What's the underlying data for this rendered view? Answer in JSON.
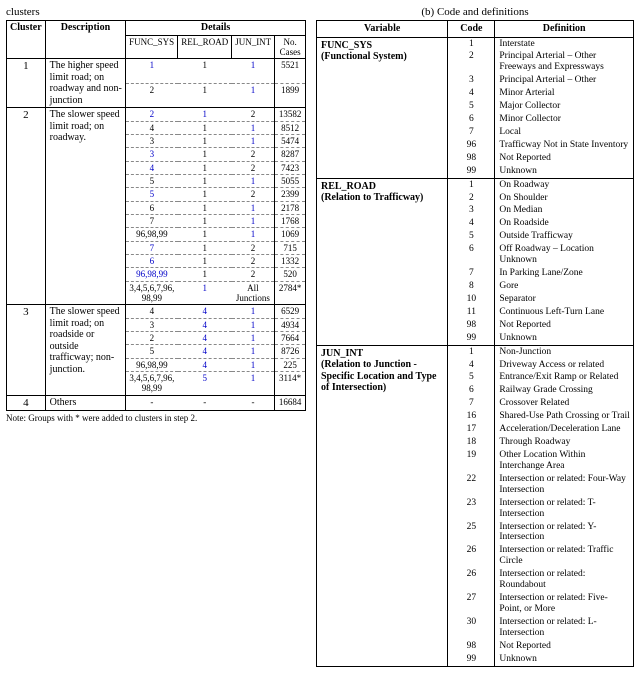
{
  "caption_left": "clusters",
  "caption_right": "(b) Code and definitions",
  "left_headers": {
    "cluster": "Cluster",
    "description": "Description",
    "details": "Details",
    "func_sys": "FUNC_SYS",
    "rel_road": "REL_ROAD",
    "jun_int": "JUN_INT",
    "cases": "No. Cases"
  },
  "right_headers": {
    "variable": "Variable",
    "code": "Code",
    "definition": "Definition"
  },
  "note": "Note: Groups with * were added to clusters in step 2.",
  "cluster1": {
    "id": "1",
    "desc": "The higher speed limit road; on roadway and non-junction",
    "rows": [
      {
        "f": "1",
        "r": "1",
        "j": "1",
        "n": "5521",
        "fb": true,
        "jb": true
      },
      {
        "f": "2",
        "r": "1",
        "j": "1",
        "n": "1899",
        "jb": true
      }
    ]
  },
  "cluster2": {
    "id": "2",
    "desc": "The slower speed limit road; on roadway.",
    "rows": [
      {
        "f": "2",
        "r": "1",
        "j": "2",
        "n": "13582",
        "fb": true,
        "rb": true
      },
      {
        "f": "4",
        "r": "1",
        "j": "1",
        "n": "8512",
        "jb": true
      },
      {
        "f": "3",
        "r": "1",
        "j": "1",
        "n": "5474",
        "jb": true
      },
      {
        "f": "3",
        "r": "1",
        "j": "2",
        "n": "8287",
        "fb": true
      },
      {
        "f": "4",
        "r": "1",
        "j": "2",
        "n": "7423",
        "fb": true
      },
      {
        "f": "5",
        "r": "1",
        "j": "1",
        "n": "5055",
        "jb": true
      },
      {
        "f": "5",
        "r": "1",
        "j": "2",
        "n": "2399",
        "fb": true
      },
      {
        "f": "6",
        "r": "1",
        "j": "1",
        "n": "2178",
        "jb": true
      },
      {
        "f": "7",
        "r": "1",
        "j": "1",
        "n": "1768",
        "jb": true
      },
      {
        "f": "96,98,99",
        "r": "1",
        "j": "1",
        "n": "1069",
        "jb": true
      },
      {
        "f": "7",
        "r": "1",
        "j": "2",
        "n": "715",
        "fb": true
      },
      {
        "f": "6",
        "r": "1",
        "j": "2",
        "n": "1332",
        "fb": true
      },
      {
        "f": "96,98,99",
        "r": "1",
        "j": "2",
        "n": "520",
        "fb": true
      },
      {
        "f": "3,4,5,6,7,96,\n98,99",
        "r": "1",
        "j": "All\nJunctions",
        "n": "2784*",
        "rb": true
      }
    ]
  },
  "cluster3": {
    "id": "3",
    "desc": "The slower speed limit road; on roadside or outside trafficway; non-junction.",
    "rows": [
      {
        "f": "4",
        "r": "4",
        "j": "1",
        "n": "6529",
        "rb": true,
        "jb": true
      },
      {
        "f": "3",
        "r": "4",
        "j": "1",
        "n": "4934",
        "rb": true,
        "jb": true
      },
      {
        "f": "2",
        "r": "4",
        "j": "1",
        "n": "7664",
        "rb": true,
        "jb": true
      },
      {
        "f": "5",
        "r": "4",
        "j": "1",
        "n": "8726",
        "rb": true,
        "jb": true
      },
      {
        "f": "96,98,99",
        "r": "4",
        "j": "1",
        "n": "225",
        "rb": true,
        "jb": true
      },
      {
        "f": "3,4,5,6,7,96,\n98,99",
        "r": "5",
        "j": "1",
        "n": "3114*",
        "rb": true,
        "jb": true
      }
    ]
  },
  "cluster4": {
    "id": "4",
    "desc": "Others",
    "rows": [
      {
        "f": "-",
        "r": "-",
        "j": "-",
        "n": "16684"
      }
    ]
  },
  "right_vars": [
    {
      "name": "FUNC_SYS",
      "sub": "(Functional System)",
      "rows": [
        {
          "c": "1",
          "d": "Interstate"
        },
        {
          "c": "2",
          "d": "Principal Arterial – Other Freeways and Expressways"
        },
        {
          "c": "3",
          "d": "Principal Arterial – Other"
        },
        {
          "c": "4",
          "d": "Minor Arterial"
        },
        {
          "c": "5",
          "d": "Major Collector"
        },
        {
          "c": "6",
          "d": "Minor Collector"
        },
        {
          "c": "7",
          "d": "Local"
        },
        {
          "c": "96",
          "d": "Trafficway Not in State Inventory"
        },
        {
          "c": "98",
          "d": "Not Reported"
        },
        {
          "c": "99",
          "d": "Unknown"
        }
      ]
    },
    {
      "name": "REL_ROAD",
      "sub": "(Relation to Trafficway)",
      "rows": [
        {
          "c": "1",
          "d": "On Roadway"
        },
        {
          "c": "2",
          "d": "On Shoulder"
        },
        {
          "c": "3",
          "d": "On Median"
        },
        {
          "c": "4",
          "d": "On Roadside"
        },
        {
          "c": "5",
          "d": "Outside Trafficway"
        },
        {
          "c": "6",
          "d": "Off Roadway – Location Unknown"
        },
        {
          "c": "7",
          "d": "In Parking Lane/Zone"
        },
        {
          "c": "8",
          "d": "Gore"
        },
        {
          "c": "10",
          "d": "Separator"
        },
        {
          "c": "11",
          "d": "Continuous Left-Turn Lane"
        },
        {
          "c": "98",
          "d": "Not Reported"
        },
        {
          "c": "99",
          "d": "Unknown"
        }
      ]
    },
    {
      "name": "JUN_INT",
      "sub": "(Relation to Junction - Specific Location and Type of Intersection)",
      "rows": [
        {
          "c": "1",
          "d": "Non-Junction"
        },
        {
          "c": "4",
          "d": "Driveway Access or related"
        },
        {
          "c": "5",
          "d": "Entrance/Exit Ramp or Related"
        },
        {
          "c": "6",
          "d": "Railway Grade Crossing"
        },
        {
          "c": "7",
          "d": "Crossover Related"
        },
        {
          "c": "16",
          "d": "Shared-Use Path Crossing or Trail"
        },
        {
          "c": "17",
          "d": "Acceleration/Deceleration Lane"
        },
        {
          "c": "18",
          "d": "Through Roadway"
        },
        {
          "c": "19",
          "d": "Other Location Within Interchange Area"
        },
        {
          "c": "22",
          "d": "Intersection or related: Four-Way Intersection"
        },
        {
          "c": "23",
          "d": "Intersection or related: T-Intersection"
        },
        {
          "c": "25",
          "d": "Intersection or related: Y-Intersection"
        },
        {
          "c": "26",
          "d": "Intersection or related: Traffic Circle"
        },
        {
          "c": "26",
          "d": "Intersection or related: Roundabout"
        },
        {
          "c": "27",
          "d": "Intersection or related: Five-Point, or More"
        },
        {
          "c": "30",
          "d": "Intersection or related: L-Intersection"
        },
        {
          "c": "98",
          "d": "Not Reported"
        },
        {
          "c": "99",
          "d": "Unknown"
        }
      ]
    }
  ]
}
